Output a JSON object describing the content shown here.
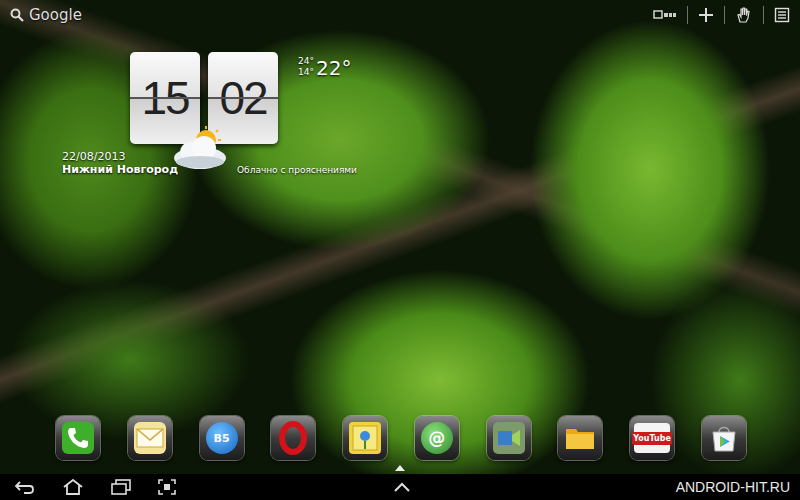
{
  "search": {
    "label": "Google"
  },
  "clock": {
    "hours": "15",
    "minutes": "02",
    "date": "22/08/2013",
    "city": "Нижний Новгород"
  },
  "weather": {
    "high": "24°",
    "low": "14°",
    "temp": "22°",
    "condition": "Облачно с прояснениями"
  },
  "dock": [
    {
      "kind": "phone"
    },
    {
      "kind": "messages"
    },
    {
      "kind": "browser",
      "label": "B5"
    },
    {
      "kind": "opera"
    },
    {
      "kind": "gallery"
    },
    {
      "kind": "email",
      "label": "@"
    },
    {
      "kind": "video"
    },
    {
      "kind": "files"
    },
    {
      "kind": "youtube",
      "label": "YouTube"
    },
    {
      "kind": "market"
    }
  ],
  "watermark": "ANDROID-HIT.RU"
}
